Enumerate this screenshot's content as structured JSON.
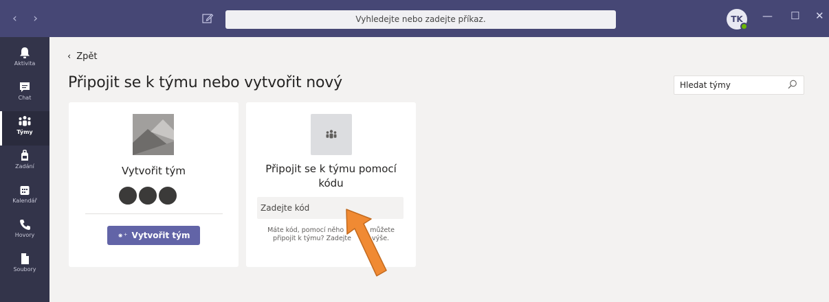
{
  "titlebar": {
    "back_arrow": "‹",
    "forward_arrow": "›",
    "search_placeholder": "Vyhledejte nebo zadejte příkaz.",
    "avatar_initials": "TK",
    "minimize": "—",
    "maximize": "☐",
    "close": "✕",
    "presence_color": "#6bb700"
  },
  "rail": {
    "items": [
      {
        "label": "Aktivita",
        "icon": "bell-icon"
      },
      {
        "label": "Chat",
        "icon": "chat-icon"
      },
      {
        "label": "Týmy",
        "icon": "teams-icon",
        "active": true
      },
      {
        "label": "Zadání",
        "icon": "assignments-icon"
      },
      {
        "label": "Kalendář",
        "icon": "calendar-icon"
      },
      {
        "label": "Hovory",
        "icon": "phone-icon"
      },
      {
        "label": "Soubory",
        "icon": "files-icon"
      }
    ]
  },
  "main": {
    "back_label": "Zpět",
    "title": "Připojit se k týmu nebo vytvořit nový",
    "team_search_placeholder": "Hledat týmy"
  },
  "create_card": {
    "title": "Vytvořit tým",
    "button_label": "Vytvořit tým"
  },
  "join_card": {
    "title_line1": "Připojit se k týmu pomocí",
    "title_line2": "kódu",
    "code_placeholder": "Zadejte kód",
    "hint_part1": "Máte kód, pomocí něho",
    "hint_part2": "můžete",
    "hint_part3": "připojit k týmu? Zadejte",
    "hint_part4": "výše."
  },
  "colors": {
    "titlebar": "#464775",
    "rail": "#33344a",
    "accent": "#6264a7",
    "annotation_arrow": "#f08a33"
  }
}
